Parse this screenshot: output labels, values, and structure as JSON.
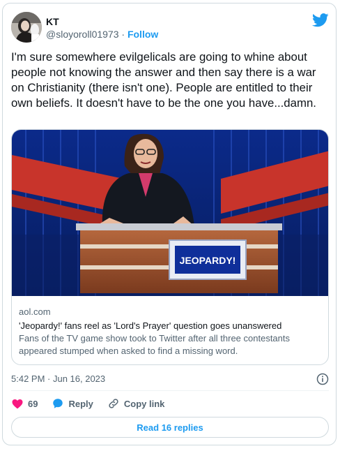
{
  "author": {
    "display_name": "KT",
    "handle": "@sloyoroll01973",
    "separator": " · ",
    "follow_label": "Follow",
    "avatar_icon": "avatar-photo"
  },
  "brand_icon": "twitter-bird-icon",
  "tweet": {
    "text": "I'm sure somewhere evilgelicals are going to whine about people not knowing the answer and then say there is a war on Christianity (there isn't one). People are entitled to their own beliefs. It doesn't have to be the one you have...damn."
  },
  "link_card": {
    "domain": "aol.com",
    "title": "'Jeopardy!' fans reel as 'Lord's Prayer' question goes unanswered",
    "description": "Fans of the TV game show took to Twitter after all three contestants appeared stumped when asked to find a missing word.",
    "podium_text": "JEOPARDY!"
  },
  "meta": {
    "timestamp": "5:42 PM · Jun 16, 2023"
  },
  "actions": {
    "like_count": "69",
    "reply_label": "Reply",
    "copy_link_label": "Copy link",
    "read_replies_label": "Read 16 replies"
  },
  "colors": {
    "accent": "#1d9bf0",
    "like": "#f91880",
    "text": "#0f1419",
    "secondary": "#536471"
  }
}
